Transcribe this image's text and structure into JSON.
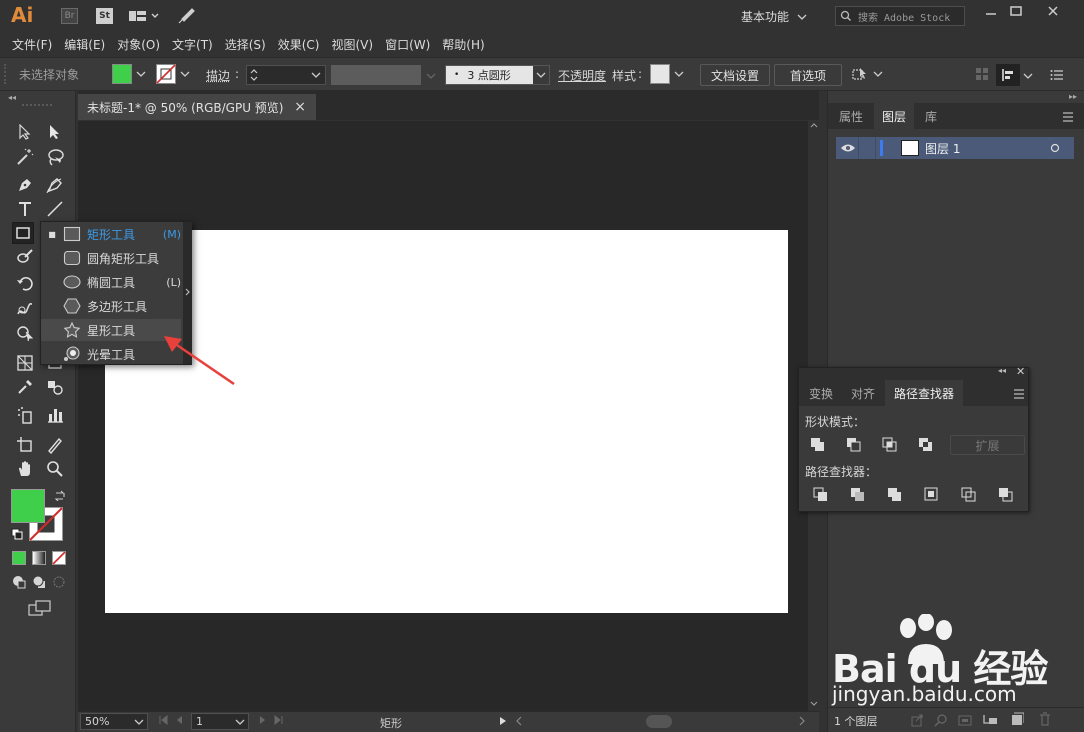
{
  "app": {
    "logo": "Ai",
    "br_badge": "Br",
    "st_badge": "St"
  },
  "titlebar": {
    "workspace": "基本功能",
    "search_placeholder": "搜索 Adobe Stock"
  },
  "menu": [
    "文件(F)",
    "编辑(E)",
    "对象(O)",
    "文字(T)",
    "选择(S)",
    "效果(C)",
    "视图(V)",
    "窗口(W)",
    "帮助(H)"
  ],
  "control_bar": {
    "selection_status": "未选择对象",
    "stroke_label": "描边",
    "brush_value": "3 点圆形",
    "opacity_label": "不透明度",
    "style_label": "样式",
    "doc_setup": "文档设置",
    "preferences": "首选项"
  },
  "document": {
    "tab_title": "未标题-1* @ 50% (RGB/GPU 预览)",
    "close": "×"
  },
  "flyout": {
    "items": [
      {
        "label": "矩形工具",
        "shortcut": "(M)",
        "icon": "rectangle-icon",
        "selected": true
      },
      {
        "label": "圆角矩形工具",
        "shortcut": "",
        "icon": "rounded-rectangle-icon",
        "selected": false
      },
      {
        "label": "椭圆工具",
        "shortcut": "(L)",
        "icon": "ellipse-icon",
        "selected": false
      },
      {
        "label": "多边形工具",
        "shortcut": "",
        "icon": "polygon-icon",
        "selected": false
      },
      {
        "label": "星形工具",
        "shortcut": "",
        "icon": "star-icon",
        "selected": false
      },
      {
        "label": "光晕工具",
        "shortcut": "",
        "icon": "flare-icon",
        "selected": false
      }
    ]
  },
  "status": {
    "zoom": "50%",
    "artboard_number": "1",
    "tool_name": "矩形"
  },
  "right_panel": {
    "tabs": [
      "属性",
      "图层",
      "库"
    ],
    "active_tab": "图层",
    "layer_name": "图层 1",
    "layer_count": "1 个图层"
  },
  "pathfinder": {
    "tabs": [
      "变换",
      "对齐",
      "路径查找器"
    ],
    "active_tab": "路径查找器",
    "shape_modes_label": "形状模式：",
    "expand_button": "扩展",
    "pathfinders_label": "路径查找器："
  },
  "watermark": {
    "brand": "Bai du 经验",
    "url": "jingyan.baidu.com"
  },
  "colors": {
    "fill": "#3fcf4a",
    "accent": "#3d9ae8",
    "arrow": "#e8403a",
    "selected_layer": "#4a5a78"
  }
}
